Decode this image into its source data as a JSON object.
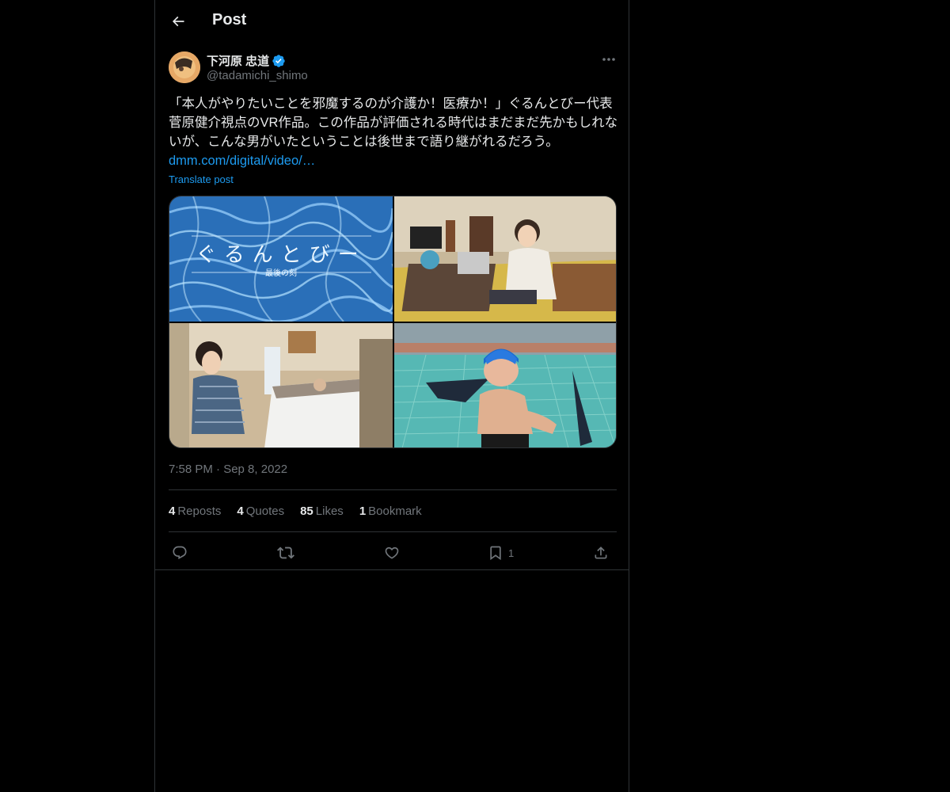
{
  "header": {
    "title": "Post"
  },
  "author": {
    "name": "下河原 忠道",
    "handle": "@tadamichi_shimo"
  },
  "post": {
    "text": "「本人がやりたいことを邪魔するのが介護か！医療か！」ぐるんとびー代表 菅原健介視点のVR作品。この作品が評価される時代はまだまだ先かもしれないが、こんな男がいたということは後世まで語り継がれるだろう。",
    "link": "dmm.com/digital/video/…",
    "translate_label": "Translate post",
    "media_title_text": "ぐるんとびー",
    "media_subtitle_text": "最後の刻",
    "timestamp": "7:58 PM · Sep 8, 2022"
  },
  "stats": [
    {
      "count": "4",
      "label": "Reposts"
    },
    {
      "count": "4",
      "label": "Quotes"
    },
    {
      "count": "85",
      "label": "Likes"
    },
    {
      "count": "1",
      "label": "Bookmark"
    }
  ],
  "actions": {
    "bookmark_count": "1"
  },
  "colors": {
    "background": "#000000",
    "text": "#e7e9ea",
    "muted": "#71767b",
    "accent": "#1d9bf0",
    "border": "#2f3336"
  }
}
